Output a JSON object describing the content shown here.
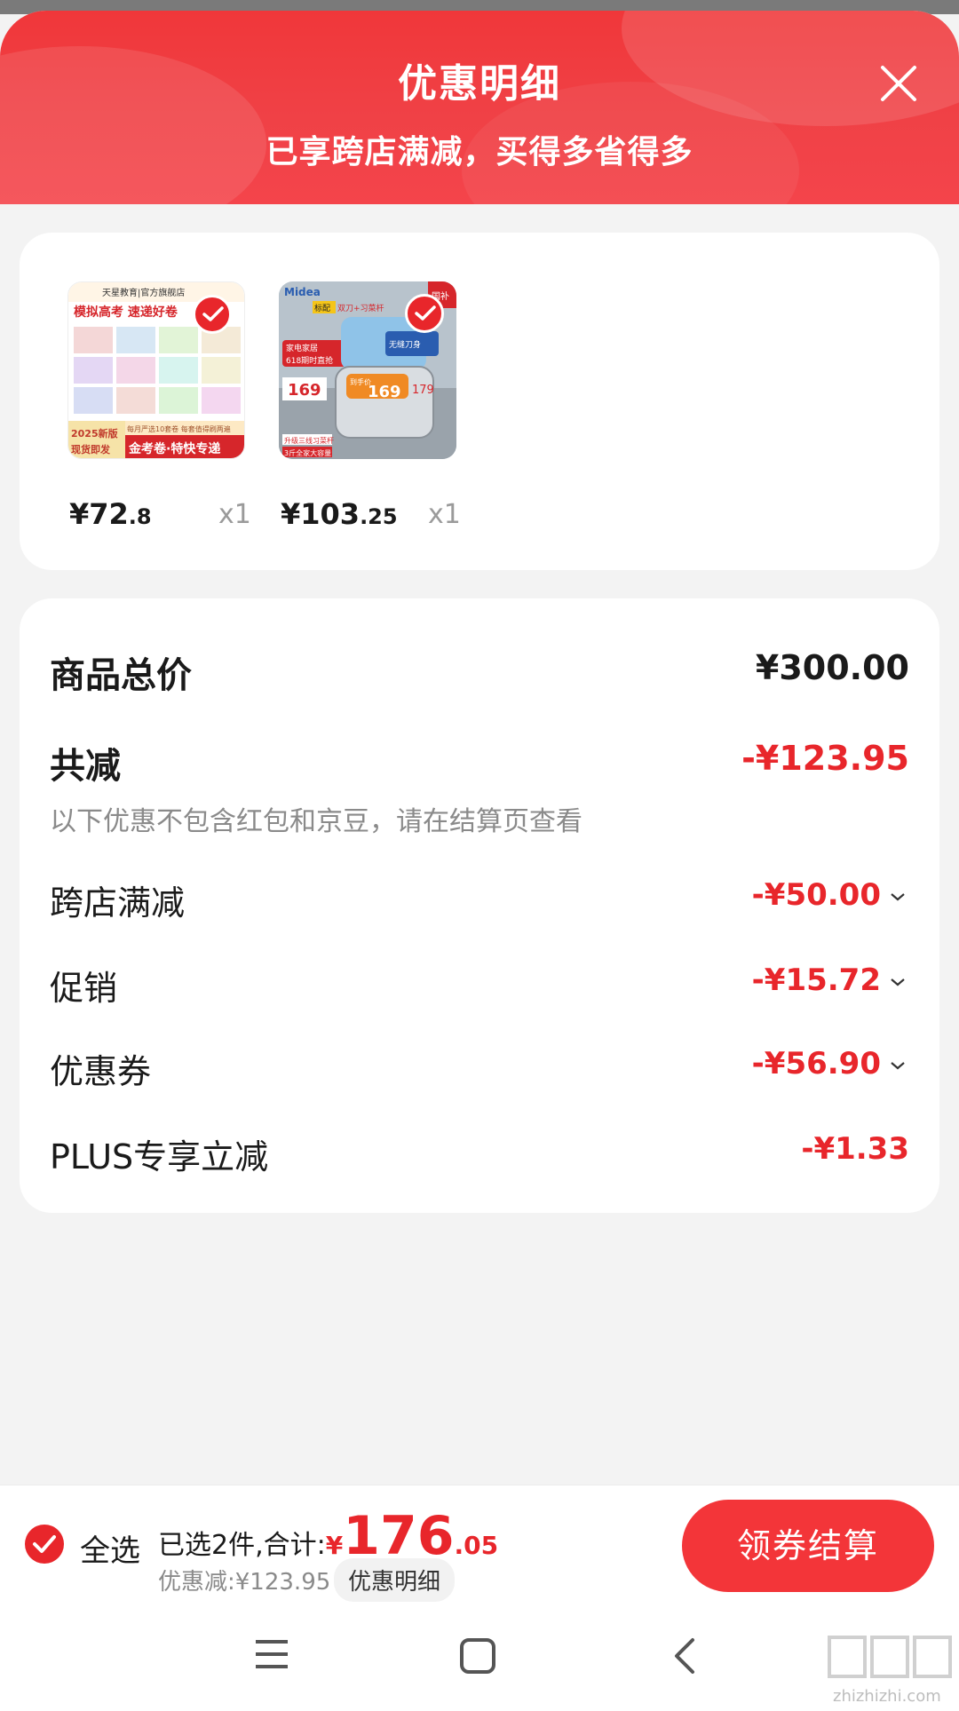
{
  "header": {
    "title": "优惠明细",
    "subtitle": "已享跨店满减，买得多省得多"
  },
  "products": [
    {
      "price_int": "¥72",
      "price_dec": ".8",
      "qty": "x1",
      "thumb_text": [
        "天星教育|官方旗舰店",
        "模拟高考 速递好卷",
        "2025新版",
        "现货即发",
        "金考卷·特快专递",
        "每月严选10套卷 每套值得刷两遍"
      ]
    },
    {
      "price_int": "¥103",
      "price_dec": ".25",
      "qty": "x1",
      "thumb_text": [
        "Midea",
        "标配",
        "双刀+习菜杆",
        "家电家居",
        "618期时直抢",
        "169",
        "无缝刀身",
        "到手价",
        "179",
        "3斤全家大容量",
        "升级三线习菜杆",
        "国补"
      ]
    }
  ],
  "summary": {
    "total_label": "商品总价",
    "total_value": "¥300.00",
    "reduce_label": "共减",
    "reduce_value": "-¥123.95",
    "note": "以下优惠不包含红包和京豆，请在结算页查看",
    "items": [
      {
        "label": "跨店满减",
        "value": "-¥50.00"
      },
      {
        "label": "促销",
        "value": "-¥15.72"
      },
      {
        "label": "优惠券",
        "value": "-¥56.90"
      },
      {
        "label": "PLUS专享立减",
        "value": "-¥1.33"
      }
    ]
  },
  "bottom_bar": {
    "select_all": "全选",
    "selected_text": "已选2件,合计:",
    "total_symbol": "¥",
    "total_int": "176",
    "total_dec": ".05",
    "discount_text": "优惠减:¥123.95",
    "detail_chip": "优惠明细",
    "checkout": "领券结算"
  },
  "watermark": "zhizhizhi.com",
  "colors": {
    "accent_red": "#e8262b",
    "header_red": "#f0373a",
    "button_red": "#f33539"
  }
}
